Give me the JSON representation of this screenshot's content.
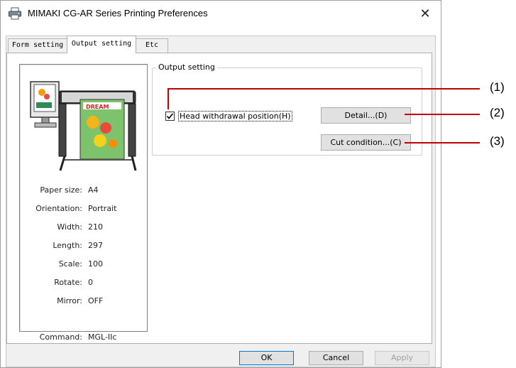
{
  "window": {
    "title": "MIMAKI CG-AR Series Printing Preferences",
    "close_glyph": "✕"
  },
  "tabs": [
    {
      "label": "Form setting",
      "active": false
    },
    {
      "label": "Output setting",
      "active": true
    },
    {
      "label": "Etc",
      "active": false
    }
  ],
  "info": {
    "rows": [
      {
        "label": "Paper size:",
        "value": "A4"
      },
      {
        "label": "Orientation:",
        "value": "Portrait"
      },
      {
        "label": "Width:",
        "value": "210"
      },
      {
        "label": "Length:",
        "value": "297"
      },
      {
        "label": "Scale:",
        "value": "100"
      },
      {
        "label": "Rotate:",
        "value": "0"
      },
      {
        "label": "Mirror:",
        "value": "OFF"
      }
    ],
    "command": {
      "label": "Command:",
      "value": "MGL-IIc"
    }
  },
  "output_group": {
    "legend": "Output setting",
    "head_withdrawal": {
      "label": "Head withdrawal position(H)",
      "checked": true
    },
    "detail_button": "Detail...(D)",
    "cut_condition_button": "Cut condition...(C)"
  },
  "footer": {
    "ok": "OK",
    "cancel": "Cancel",
    "apply": "Apply"
  },
  "annotations": [
    "(1)",
    "(2)",
    "(3)"
  ],
  "colors": {
    "callout": "#c00000",
    "default_button_border": "#0078d7"
  }
}
